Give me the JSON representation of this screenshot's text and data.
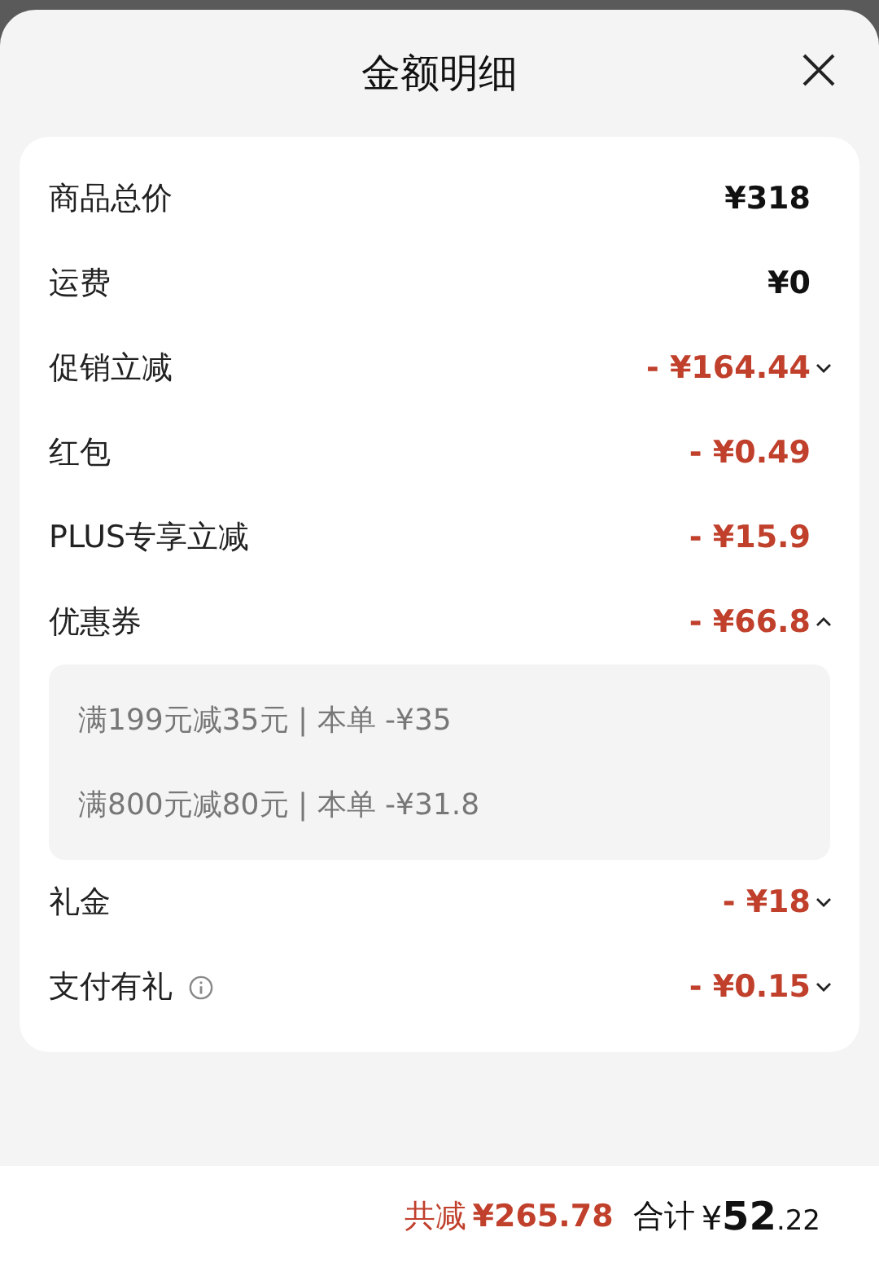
{
  "title": "金额明细",
  "rows": [
    {
      "label": "商品总价",
      "amount": "¥318",
      "kind": "price",
      "info": false
    },
    {
      "label": "运费",
      "amount": "¥0",
      "kind": "price",
      "info": false
    },
    {
      "label": "促销立减",
      "amount": "- ¥164.44",
      "kind": "discount",
      "info": false,
      "expanded": false
    },
    {
      "label": "红包",
      "amount": "- ¥0.49",
      "kind": "discount",
      "info": false
    },
    {
      "label": "PLUS专享立减",
      "amount": "- ¥15.9",
      "kind": "discount",
      "info": false
    },
    {
      "label": "优惠券",
      "amount": "- ¥66.8",
      "kind": "discount",
      "info": false,
      "expanded": true,
      "details": [
        "满199元减35元 | 本单 -¥35",
        "满800元减80元 | 本单 -¥31.8"
      ]
    },
    {
      "label": "礼金",
      "amount": "- ¥18",
      "kind": "discount",
      "info": false,
      "expanded": false
    },
    {
      "label": "支付有礼",
      "amount": "- ¥0.15",
      "kind": "discount",
      "info": true,
      "expanded": false
    }
  ],
  "footer": {
    "savings_label": "共减",
    "savings": "¥265.78",
    "total_label": "合计",
    "currency": "¥",
    "integer": "52",
    "decimal": ".22"
  }
}
